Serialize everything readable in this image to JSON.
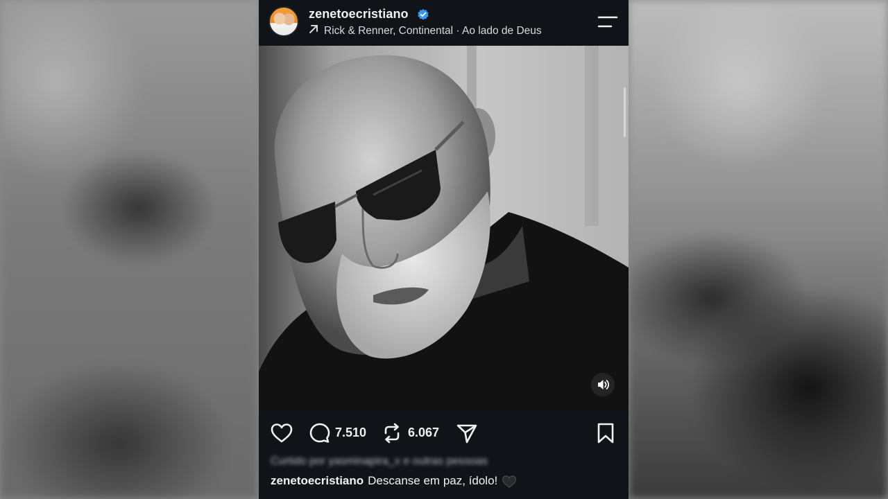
{
  "post": {
    "username": "zenetoecristiano",
    "audio_line": "Rick & Renner, Continental · Ao lado de Deus"
  },
  "actions": {
    "comments_count": "7.510",
    "reposts_count": "6.067"
  },
  "liked_by": {
    "text": "Curtido por yasminapira_x e outras pessoas"
  },
  "caption": {
    "username": "zenetoecristiano",
    "text": "Descanse em paz, ídolo!"
  },
  "colors": {
    "verified": "#3897f0",
    "background": "#101418"
  }
}
